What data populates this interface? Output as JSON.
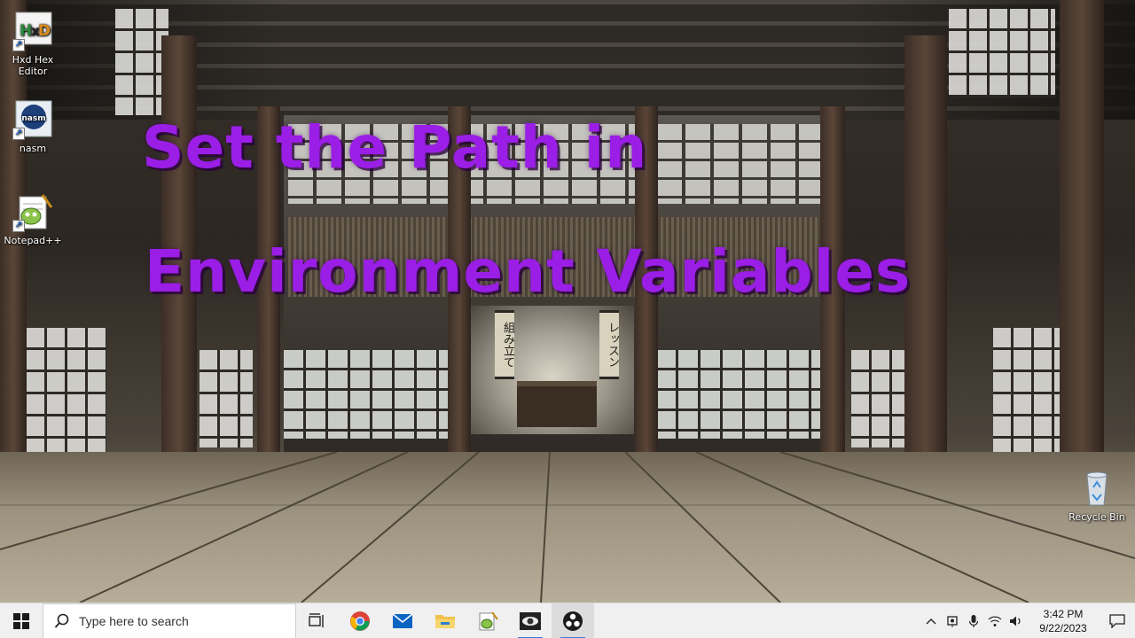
{
  "desktop": {
    "title_lines": [
      "Set the Path in",
      "Environment Variables"
    ],
    "scroll_left": "組み立て",
    "scroll_right": "レッスン",
    "icons": [
      {
        "label": "Hxd Hex Editor",
        "icon": "hxd-icon"
      },
      {
        "label": "nasm",
        "icon": "nasm-icon"
      },
      {
        "label": "Notepad++",
        "icon": "notepadpp-icon"
      },
      {
        "label": "Recycle Bin",
        "icon": "recycle-bin-icon"
      }
    ],
    "hxd_logo_text": "HxD",
    "nasm_logo_text": "nasm"
  },
  "taskbar": {
    "search_placeholder": "Type here to search",
    "apps": [
      {
        "name": "task-view",
        "icon": "task-view-icon"
      },
      {
        "name": "chrome",
        "icon": "chrome-icon"
      },
      {
        "name": "mail",
        "icon": "mail-icon"
      },
      {
        "name": "file-explorer",
        "icon": "folder-icon"
      },
      {
        "name": "notepad-plus-plus",
        "icon": "notepadpp-icon"
      },
      {
        "name": "eye-app",
        "icon": "eye-icon"
      },
      {
        "name": "obs",
        "icon": "obs-icon"
      }
    ],
    "clock": {
      "time": "3:42 PM",
      "date": "9/22/2023"
    }
  },
  "colors": {
    "title_text": "#9a1ee6",
    "taskbar_bg": "#f0f0f0",
    "accent": "#3a7bd5"
  }
}
